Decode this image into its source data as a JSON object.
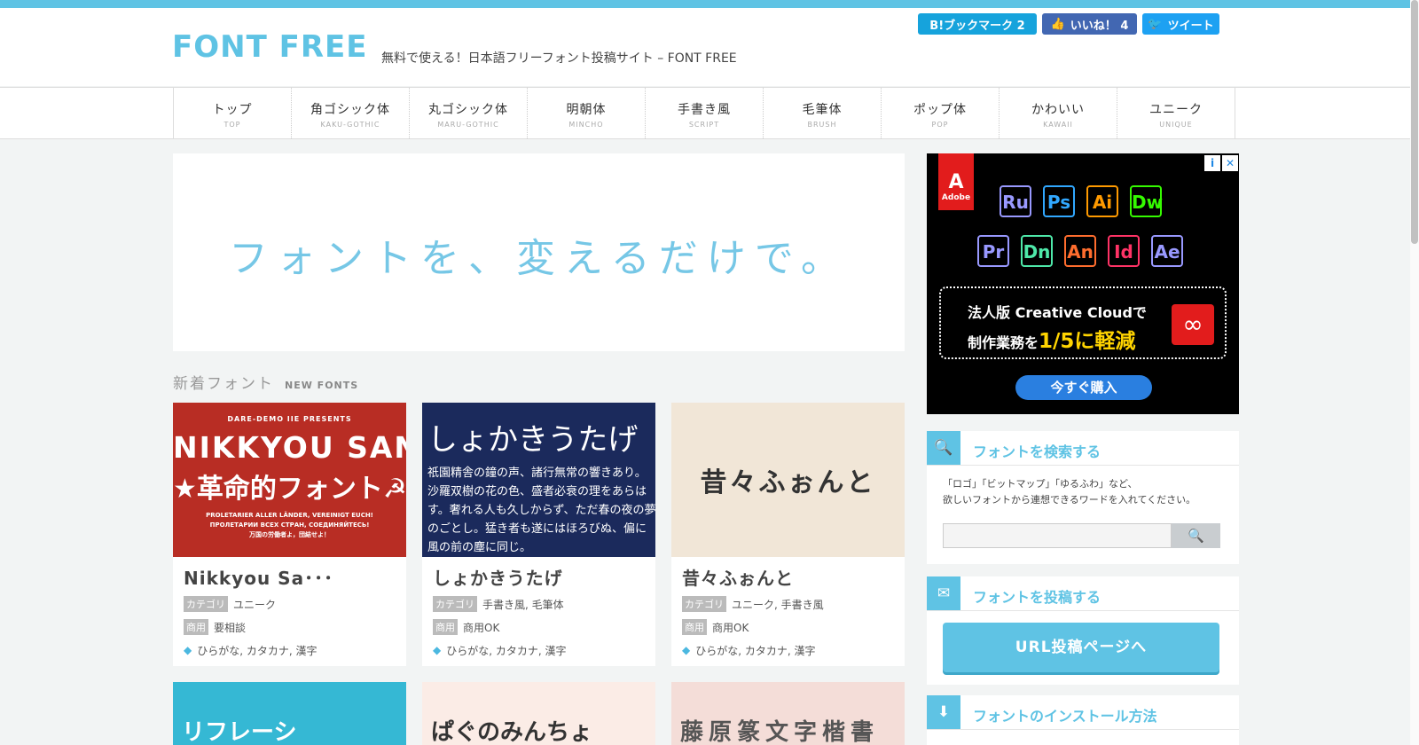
{
  "site": {
    "logo": "FONT FREE",
    "tagline": "無料で使える！日本語フリーフォント投稿サイト – FONT FREE"
  },
  "social": {
    "hatena": "B!ブックマーク  2",
    "facebook": "いいね！ 4",
    "twitter": "ツイート"
  },
  "nav": [
    {
      "jp": "トップ",
      "en": "TOP"
    },
    {
      "jp": "角ゴシック体",
      "en": "KAKU-GOTHIC"
    },
    {
      "jp": "丸ゴシック体",
      "en": "MARU-GOTHIC"
    },
    {
      "jp": "明朝体",
      "en": "MINCHO"
    },
    {
      "jp": "手書き風",
      "en": "SCRIPT"
    },
    {
      "jp": "毛筆体",
      "en": "BRUSH"
    },
    {
      "jp": "ポップ体",
      "en": "POP"
    },
    {
      "jp": "かわいい",
      "en": "KAWAII"
    },
    {
      "jp": "ユニーク",
      "en": "UNIQUE"
    }
  ],
  "hero": {
    "text": "フォントを、変えるだけで。"
  },
  "new_fonts": {
    "title": "新着フォント",
    "subtitle": "NEW FONTS"
  },
  "labels": {
    "category": "カテゴリ",
    "commercial": "商用"
  },
  "cards": [
    {
      "title": "Nikkyou Sa･･･",
      "category": "ユニーク",
      "commercial": "要相談",
      "chars": "ひらがな, カタカナ, 漢字",
      "thumb": {
        "small": "DARE-DEMO IIE PRESENTS",
        "big": "NIKKYOU SANS",
        "jp": "★革命的フォント☭",
        "foot1": "PROLETARIER ALLER LÄNDER, VEREINIGT EUCH!",
        "foot2": "ПРОЛЕТАРИИ ВСЕХ СТРАН, СОЕДИНЯЙТЕСЬ!",
        "foot3": "万国の労働者よ，団結せよ！"
      }
    },
    {
      "title": "しょかきうたげ",
      "category": "手書き風,  毛筆体",
      "commercial": "商用OK",
      "chars": "ひらがな, カタカナ, 漢字",
      "thumb": {
        "big": "しょかきうたげ",
        "line1": "祇園精舎の鐘の声、諸行無常の響きあり。",
        "line2": "沙羅双樹の花の色、盛者必衰の理をあらは",
        "line3": "す。奢れる人も久しからず、ただ春の夜の夢",
        "line4": "のごとし。猛き者も遂にはほろびぬ、偏に",
        "line5": "風の前の塵に同じ。"
      }
    },
    {
      "title": "昔々ふぉんと",
      "category": "ユニーク,  手書き風",
      "commercial": "商用OK",
      "chars": "ひらがな, カタカナ, 漢字",
      "thumb": {
        "big": "昔々ふぉんと"
      }
    }
  ],
  "cards_row2": [
    {
      "text": "リフレーシ"
    },
    {
      "text": "ぱぐのみんちょ"
    },
    {
      "text": "藤原篆文字楷書"
    }
  ],
  "ad": {
    "brand": "Adobe",
    "apps": [
      {
        "name": "Ru",
        "color": "#9999ff"
      },
      {
        "name": "Ps",
        "color": "#31a8ff"
      },
      {
        "name": "Ai",
        "color": "#ff9a00"
      },
      {
        "name": "Dw",
        "color": "#35fa00"
      },
      {
        "name": "Pr",
        "color": "#9999ff"
      },
      {
        "name": "Dn",
        "color": "#4ee8a9"
      },
      {
        "name": "An",
        "color": "#ff6d2e"
      },
      {
        "name": "Id",
        "color": "#ff3366"
      },
      {
        "name": "Ae",
        "color": "#9999ff"
      }
    ],
    "line1": "法人版 Creative Cloudで",
    "line2_prefix": "制作業務を",
    "line2_highlight": "1/5に軽減",
    "button": "今すぐ購入"
  },
  "search_widget": {
    "title": "フォントを検索する",
    "desc1": "「ロゴ」「ビットマップ」「ゆるふわ」など、",
    "desc2": "欲しいフォントから連想できるワードを入れてください。",
    "placeholder": ""
  },
  "post_widget": {
    "title": "フォントを投稿する",
    "button": "URL投稿ページへ"
  },
  "install_widget": {
    "title": "フォントのインストール方法"
  }
}
